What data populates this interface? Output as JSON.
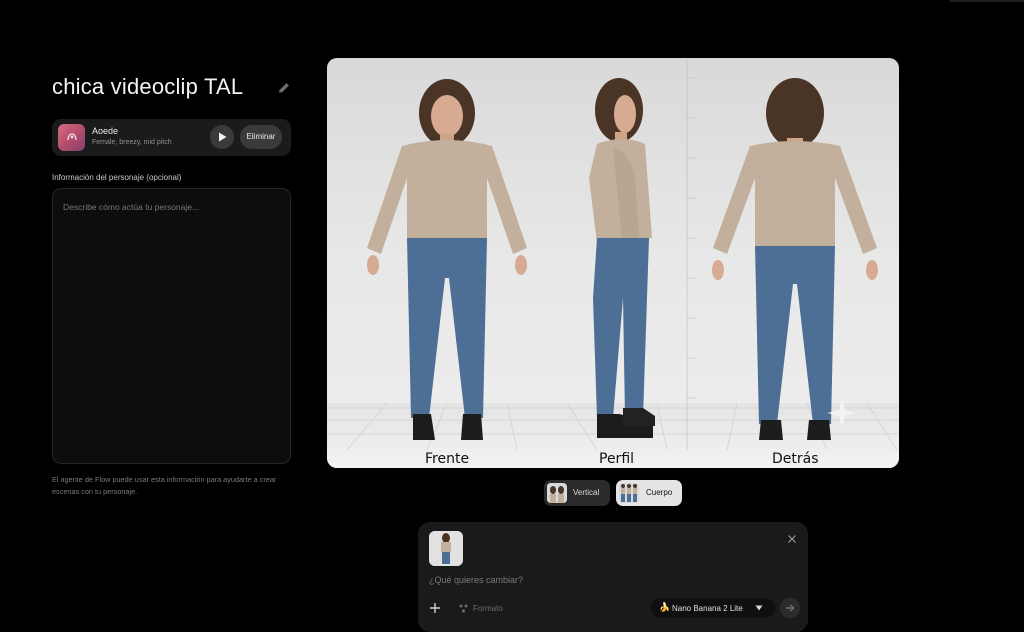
{
  "character": {
    "name": "chica videoclip TAL"
  },
  "voice": {
    "name": "Aoede",
    "description": "Female, breezy, mid pitch",
    "delete_label": "Eliminar"
  },
  "info": {
    "label": "Información del personaje (opcional)",
    "placeholder": "Describe cómo actúa tu personaje...",
    "hint": "El agente de Flow puede usar esta información para ayudarte a crear escenas con tu personaje."
  },
  "sheet": {
    "labels": [
      "Frente",
      "Perfil",
      "Detrás"
    ]
  },
  "view_toggle": {
    "options": [
      {
        "label": "Vertical",
        "selected": false
      },
      {
        "label": "Cuerpo",
        "selected": true
      }
    ]
  },
  "prompt": {
    "placeholder": "¿Qué quieres cambiar?",
    "format_label": "Formato",
    "model_emoji": "🍌",
    "model_label": "Nano Banana 2 Lite"
  },
  "colors": {
    "background": "#000000",
    "card": "#1a1a1a",
    "sweater": "#c2b09c",
    "jeans": "#4d6f96",
    "hair": "#4a3426"
  },
  "icons": {
    "edit": "pencil-icon",
    "voice": "voice-avatar-icon",
    "play": "play-icon",
    "close": "close-icon",
    "add": "plus-icon",
    "format": "format-icon",
    "dropdown": "chevron-down-icon",
    "send": "arrow-right-icon"
  }
}
